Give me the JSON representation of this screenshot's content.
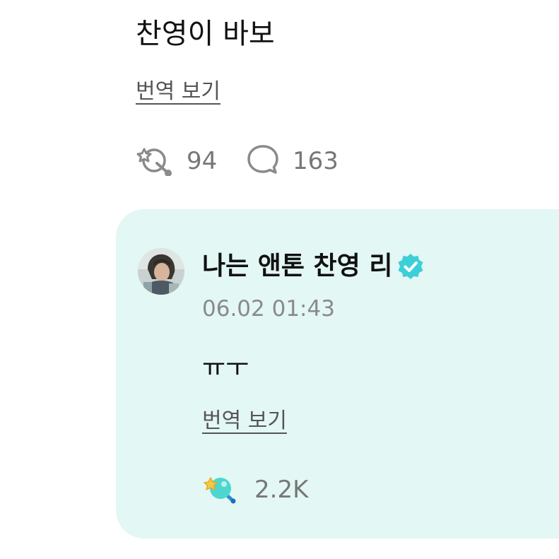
{
  "post": {
    "text": "찬영이 바보",
    "translate_label": "번역 보기",
    "like_count": "94",
    "comment_count": "163"
  },
  "reply": {
    "author_name": "나는 앤톤 찬영 리",
    "timestamp": "06.02 01:43",
    "text": "ㅠㅜ",
    "translate_label": "번역 보기",
    "like_count": "2.2K"
  },
  "colors": {
    "card_background": "#e3f7f5",
    "verified_badge": "#3ccfd8",
    "muted_text": "#8a8a8a"
  },
  "icons": {
    "like": "star-wand-icon",
    "comment": "speech-bubble-icon",
    "verified": "verified-badge-icon",
    "reply_like": "colored-star-wand-icon"
  }
}
